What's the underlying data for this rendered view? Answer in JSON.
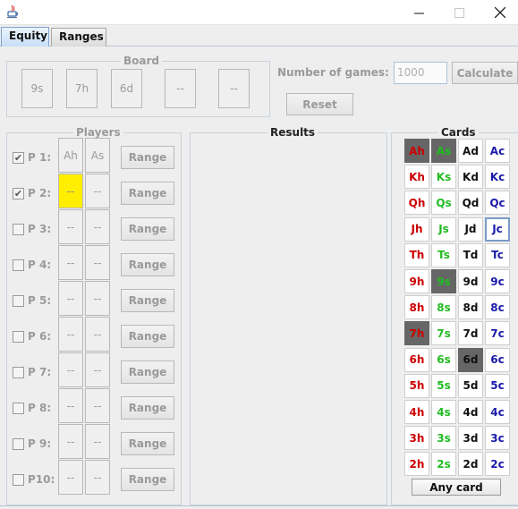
{
  "tabs": [
    {
      "label": "Equity",
      "active": true
    },
    {
      "label": "Ranges",
      "active": false
    }
  ],
  "board": {
    "title": "Board",
    "cards": [
      "9s",
      "7h",
      "6d",
      "--",
      "--"
    ]
  },
  "controls": {
    "games_label": "Number of games:",
    "games_value": "1000",
    "calculate_label": "Calculate",
    "reset_label": "Reset"
  },
  "players": {
    "title": "Players",
    "rows": [
      {
        "label": "P 1:",
        "checked": true,
        "cards": [
          "Ah",
          "As"
        ],
        "range_label": "Range",
        "highlight": false
      },
      {
        "label": "P 2:",
        "checked": true,
        "cards": [
          "--",
          "--"
        ],
        "range_label": "Range",
        "highlight": true
      },
      {
        "label": "P 3:",
        "checked": false,
        "cards": [
          "--",
          "--"
        ],
        "range_label": "Range",
        "highlight": false
      },
      {
        "label": "P 4:",
        "checked": false,
        "cards": [
          "--",
          "--"
        ],
        "range_label": "Range",
        "highlight": false
      },
      {
        "label": "P 5:",
        "checked": false,
        "cards": [
          "--",
          "--"
        ],
        "range_label": "Range",
        "highlight": false
      },
      {
        "label": "P 6:",
        "checked": false,
        "cards": [
          "--",
          "--"
        ],
        "range_label": "Range",
        "highlight": false
      },
      {
        "label": "P 7:",
        "checked": false,
        "cards": [
          "--",
          "--"
        ],
        "range_label": "Range",
        "highlight": false
      },
      {
        "label": "P 8:",
        "checked": false,
        "cards": [
          "--",
          "--"
        ],
        "range_label": "Range",
        "highlight": false
      },
      {
        "label": "P 9:",
        "checked": false,
        "cards": [
          "--",
          "--"
        ],
        "range_label": "Range",
        "highlight": false
      },
      {
        "label": "P10:",
        "checked": false,
        "cards": [
          "--",
          "--"
        ],
        "range_label": "Range",
        "highlight": false
      }
    ]
  },
  "results": {
    "title": "Results"
  },
  "cards_panel": {
    "title": "Cards",
    "suit_colors": [
      "#cc0000",
      "#22bb22",
      "#111111",
      "#1a1aaa"
    ],
    "grid": [
      [
        {
          "t": "Ah",
          "sel": true
        },
        {
          "t": "As",
          "sel": true
        },
        {
          "t": "Ad"
        },
        {
          "t": "Ac"
        }
      ],
      [
        {
          "t": "Kh"
        },
        {
          "t": "Ks"
        },
        {
          "t": "Kd"
        },
        {
          "t": "Kc"
        }
      ],
      [
        {
          "t": "Qh"
        },
        {
          "t": "Qs"
        },
        {
          "t": "Qd"
        },
        {
          "t": "Qc"
        }
      ],
      [
        {
          "t": "Jh"
        },
        {
          "t": "Js"
        },
        {
          "t": "Jd"
        },
        {
          "t": "Jc",
          "focus": true
        }
      ],
      [
        {
          "t": "Th"
        },
        {
          "t": "Ts"
        },
        {
          "t": "Td"
        },
        {
          "t": "Tc"
        }
      ],
      [
        {
          "t": "9h"
        },
        {
          "t": "9s",
          "sel": true
        },
        {
          "t": "9d"
        },
        {
          "t": "9c"
        }
      ],
      [
        {
          "t": "8h"
        },
        {
          "t": "8s"
        },
        {
          "t": "8d"
        },
        {
          "t": "8c"
        }
      ],
      [
        {
          "t": "7h",
          "sel": true
        },
        {
          "t": "7s"
        },
        {
          "t": "7d"
        },
        {
          "t": "7c"
        }
      ],
      [
        {
          "t": "6h"
        },
        {
          "t": "6s"
        },
        {
          "t": "6d",
          "sel": true
        },
        {
          "t": "6c"
        }
      ],
      [
        {
          "t": "5h"
        },
        {
          "t": "5s"
        },
        {
          "t": "5d"
        },
        {
          "t": "5c"
        }
      ],
      [
        {
          "t": "4h"
        },
        {
          "t": "4s"
        },
        {
          "t": "4d"
        },
        {
          "t": "4c"
        }
      ],
      [
        {
          "t": "3h"
        },
        {
          "t": "3s"
        },
        {
          "t": "3d"
        },
        {
          "t": "3c"
        }
      ],
      [
        {
          "t": "2h"
        },
        {
          "t": "2s"
        },
        {
          "t": "2d"
        },
        {
          "t": "2c"
        }
      ]
    ],
    "any_card_label": "Any card"
  }
}
